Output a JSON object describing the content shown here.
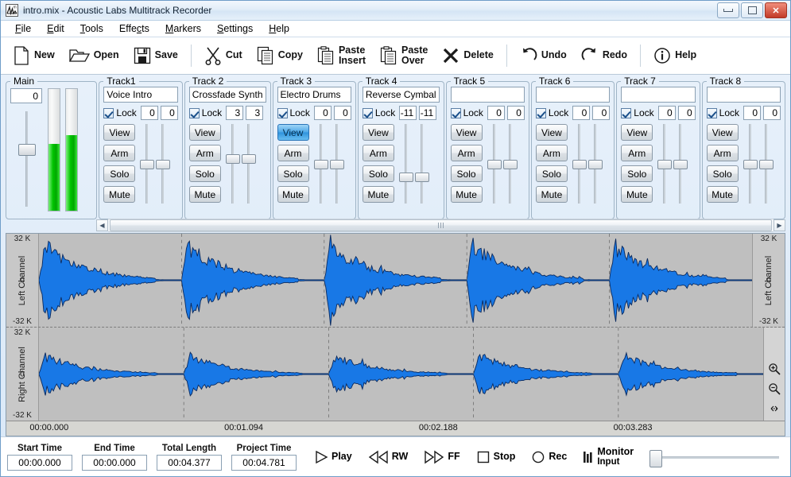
{
  "window": {
    "title": "intro.mix - Acoustic Labs Multitrack Recorder",
    "icon": "waveform-app-icon",
    "minimize": "minimize-button",
    "maximize": "maximize-button",
    "close": "close-button"
  },
  "menu": {
    "items": [
      "File",
      "Edit",
      "Tools",
      "Effects",
      "Markers",
      "Settings",
      "Help"
    ]
  },
  "toolbar": {
    "items": [
      {
        "label": "New",
        "icon": "new-file-icon"
      },
      {
        "label": "Open",
        "icon": "open-folder-icon"
      },
      {
        "label": "Save",
        "icon": "floppy-disk-icon"
      },
      {
        "label": "Cut",
        "icon": "scissors-icon"
      },
      {
        "label": "Copy",
        "icon": "copy-pages-icon"
      },
      {
        "label": "Paste",
        "label2": "Insert",
        "icon": "clipboard-insert-icon"
      },
      {
        "label": "Paste",
        "label2": "Over",
        "icon": "clipboard-over-icon"
      },
      {
        "label": "Delete",
        "icon": "x-delete-icon"
      },
      {
        "label": "Undo",
        "icon": "undo-arrow-icon"
      },
      {
        "label": "Redo",
        "icon": "redo-arrow-icon"
      },
      {
        "label": "Help",
        "icon": "info-circle-icon"
      }
    ]
  },
  "mixer": {
    "main": {
      "legend": "Main",
      "gain_value": "0",
      "fader_percent": 38,
      "meter_left_percent": 55,
      "meter_right_percent": 62
    },
    "buttons": [
      "View",
      "Arm",
      "Solo",
      "Mute"
    ],
    "lock_label": "Lock",
    "tracks": [
      {
        "legend": "Track1",
        "name": "Voice Intro",
        "lock": true,
        "pan_l": "0",
        "pan_r": "0",
        "fader_l": 50,
        "fader_r": 50,
        "view_active": false
      },
      {
        "legend": "Track 2",
        "name": "Crossfade Synth",
        "lock": true,
        "pan_l": "3",
        "pan_r": "3",
        "fader_l": 42,
        "fader_r": 42,
        "view_active": false
      },
      {
        "legend": "Track 3",
        "name": "Electro Drums",
        "lock": true,
        "pan_l": "0",
        "pan_r": "0",
        "fader_l": 50,
        "fader_r": 50,
        "view_active": true
      },
      {
        "legend": "Track 4",
        "name": "Reverse Cymbal",
        "lock": true,
        "pan_l": "-11",
        "pan_r": "-11",
        "fader_l": 68,
        "fader_r": 68,
        "view_active": false
      },
      {
        "legend": "Track 5",
        "name": "",
        "lock": true,
        "pan_l": "0",
        "pan_r": "0",
        "fader_l": 50,
        "fader_r": 50,
        "view_active": false
      },
      {
        "legend": "Track 6",
        "name": "",
        "lock": true,
        "pan_l": "0",
        "pan_r": "0",
        "fader_l": 50,
        "fader_r": 50,
        "view_active": false
      },
      {
        "legend": "Track 7",
        "name": "",
        "lock": true,
        "pan_l": "0",
        "pan_r": "0",
        "fader_l": 50,
        "fader_r": 50,
        "view_active": false
      },
      {
        "legend": "Track 8",
        "name": "",
        "lock": true,
        "pan_l": "0",
        "pan_r": "0",
        "fader_l": 50,
        "fader_r": 50,
        "view_active": false
      }
    ]
  },
  "waveform": {
    "channels": [
      {
        "label": "Left Channel",
        "top": "32 K",
        "mid": "0",
        "bottom": "-32 K",
        "amplitude": 1.0
      },
      {
        "label": "Right Channel",
        "top": "32 K",
        "mid": "0",
        "bottom": "-32 K",
        "amplitude": 0.52
      }
    ],
    "ruler_ticks": [
      "00:00.000",
      "00:01.094",
      "00:02.188",
      "00:03.283"
    ],
    "ruler_tick_percents": [
      3,
      28,
      53,
      78
    ],
    "zoom_controls": [
      {
        "icon": "zoom-in-icon"
      },
      {
        "icon": "zoom-out-icon"
      },
      {
        "icon": "fit-horizontal-icon"
      }
    ],
    "wave_color": "#1878E6",
    "wave_outline": "#0b2a5e",
    "background": "#bfbfbf",
    "burst_count": 5
  },
  "transport": {
    "fields": [
      {
        "caption": "Start Time",
        "value": "00:00.000"
      },
      {
        "caption": "End Time",
        "value": "00:00.000"
      },
      {
        "caption": "Total Length",
        "value": "00:04.377"
      },
      {
        "caption": "Project Time",
        "value": "00:04.781"
      }
    ],
    "controls": [
      {
        "label": "Play",
        "icon": "play-triangle-icon"
      },
      {
        "label": "RW",
        "icon": "rewind-icon"
      },
      {
        "label": "FF",
        "icon": "fast-forward-icon"
      },
      {
        "label": "Stop",
        "icon": "stop-square-icon"
      },
      {
        "label": "Rec",
        "icon": "record-circle-icon"
      },
      {
        "label": "Monitor",
        "label2": "Input",
        "icon": "monitor-input-icon"
      }
    ],
    "position_slider_percent": 0
  }
}
